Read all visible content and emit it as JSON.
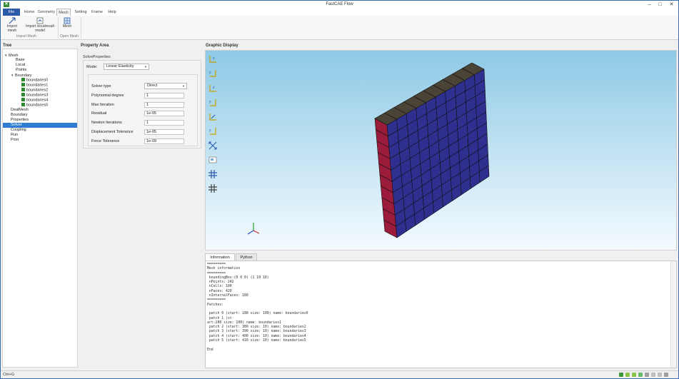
{
  "window": {
    "title": "FastCAE Flow"
  },
  "tabs": [
    {
      "label": "File"
    },
    {
      "label": "Home"
    },
    {
      "label": "Geometry"
    },
    {
      "label": "Mesh"
    },
    {
      "label": "Setting"
    },
    {
      "label": "Frame"
    },
    {
      "label": "Help"
    }
  ],
  "ribbon": {
    "import_mesh": "Import mesh",
    "import_cloudresult_line1": "Import cloudresult",
    "import_cloudresult_line2": "model",
    "group_import": "Import Mesh",
    "mesh": "Mesh",
    "group_open": "Open Mesh"
  },
  "panels": {
    "tree": "Tree",
    "property": "Property Area",
    "graphic": "Graphic Display"
  },
  "tree": {
    "mesh": "Mesh",
    "base": "Base",
    "local": "Local",
    "points": "Points",
    "boundary_group": "Boundary",
    "boundaries": [
      "boundaries0",
      "boundaries1",
      "boundaries2",
      "boundaries3",
      "boundaries4",
      "boundaries5"
    ],
    "dealmesh": "DealMesh",
    "boundary": "Boundary",
    "properties": "Properties",
    "solver": "Solver",
    "coupling": "Coupling",
    "run": "Run",
    "post": "Post"
  },
  "property": {
    "title": "SolveProperties",
    "mode_label": "Mode:",
    "mode_value": "Linear Elasticity",
    "fields": [
      {
        "label": "Solver type",
        "value": "Direct",
        "kind": "select"
      },
      {
        "label": "Polynomial degree",
        "value": "1",
        "kind": "input"
      },
      {
        "label": "Max Iteration",
        "value": "1",
        "kind": "input"
      },
      {
        "label": "Residual",
        "value": "1e-05",
        "kind": "input"
      },
      {
        "label": "Newton Iterations",
        "value": "1",
        "kind": "input"
      },
      {
        "label": "Displacement Tolerance",
        "value": "1e-05",
        "kind": "input"
      },
      {
        "label": "Force Tolerance",
        "value": "1e-09",
        "kind": "input"
      }
    ]
  },
  "info": {
    "tabs": [
      "Information",
      "Python"
    ],
    "text": "=========\nMesh information\n=========\n boundingBox:(0 0 0) (1 10 10)\n nPoints: 242\n nCells: 100\n nFaces: 420\n nInternalFaces: 180\n=========\nPatches:\n\n patch 0 (start: 180 size: 100) name: boundaries0\n patch 1 (st\nart:280 size: 100) name: boundaries1\n patch 2 (start: 380 size: 10) name: boundaries2\n patch 3 (start: 390 size: 10) name: boundaries3\n patch 4 (start: 400 size: 10) name: boundaries4\n patch 5 (start: 410 size: 10) name: boundaries5\n\nEnd"
  },
  "status": {
    "text": "Ctrl+G"
  },
  "colors": {
    "accent": "#2a5aa8",
    "selection": "#2e7dd0",
    "mesh_front": "#2e2f8f",
    "mesh_side": "#9b1b3b",
    "mesh_top": "#4a4436"
  }
}
